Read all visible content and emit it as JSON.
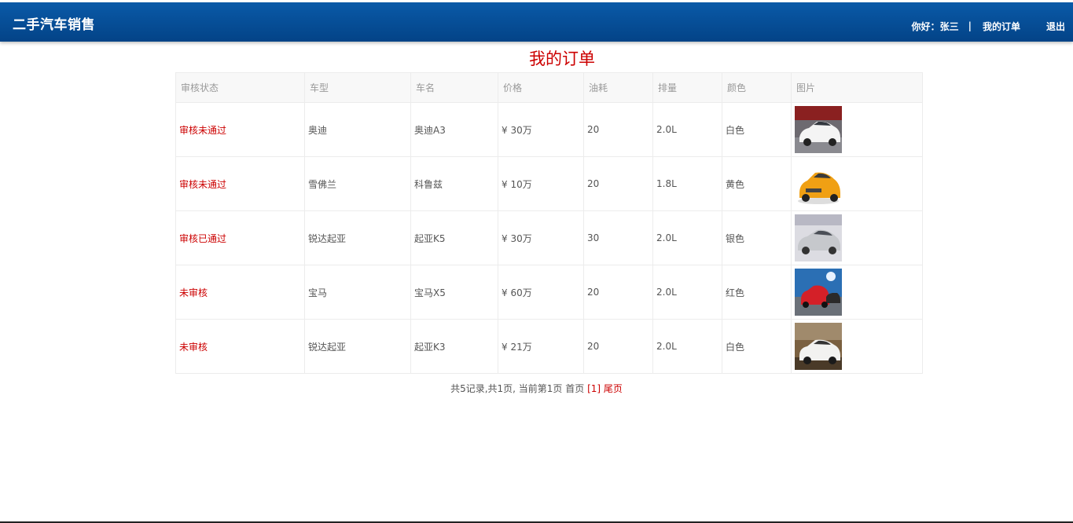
{
  "header": {
    "brand": "二手汽车销售",
    "greeting": "你好：",
    "username": "张三",
    "separator": "|",
    "my_orders": "我的订单",
    "logout": "退出"
  },
  "page_title": "我的订单",
  "table": {
    "columns": [
      "审核状态",
      "车型",
      "车名",
      "价格",
      "油耗",
      "排量",
      "颜色",
      "图片"
    ],
    "rows": [
      {
        "status": "审核未通过",
        "brand": "奥迪",
        "name": "奥迪A3",
        "price": "¥ 30万",
        "fuel": "20",
        "displacement": "2.0L",
        "color": "白色",
        "image": "white-audi-car-photo"
      },
      {
        "status": "审核未通过",
        "brand": "雪佛兰",
        "name": "科鲁兹",
        "price": "¥ 10万",
        "fuel": "20",
        "displacement": "1.8L",
        "color": "黄色",
        "image": "yellow-chevrolet-car-photo"
      },
      {
        "status": "审核已通过",
        "brand": "锐达起亚",
        "name": "起亚K5",
        "price": "¥ 30万",
        "fuel": "30",
        "displacement": "2.0L",
        "color": "银色",
        "image": "silver-kia-car-photo"
      },
      {
        "status": "未审核",
        "brand": "宝马",
        "name": "宝马X5",
        "price": "¥ 60万",
        "fuel": "20",
        "displacement": "2.0L",
        "color": "红色",
        "image": "red-bmw-car-photo"
      },
      {
        "status": "未审核",
        "brand": "锐达起亚",
        "name": "起亚K3",
        "price": "¥ 21万",
        "fuel": "20",
        "displacement": "2.0L",
        "color": "白色",
        "image": "white-kia-car-photo"
      }
    ]
  },
  "pager": {
    "summary": "共5记录,共1页, 当前第1页",
    "first": "首页",
    "current": "[1]",
    "last": "尾页"
  },
  "colors": {
    "header_top": "#0a5aa8",
    "header_bottom": "#034387",
    "accent_red": "#cc0000"
  }
}
